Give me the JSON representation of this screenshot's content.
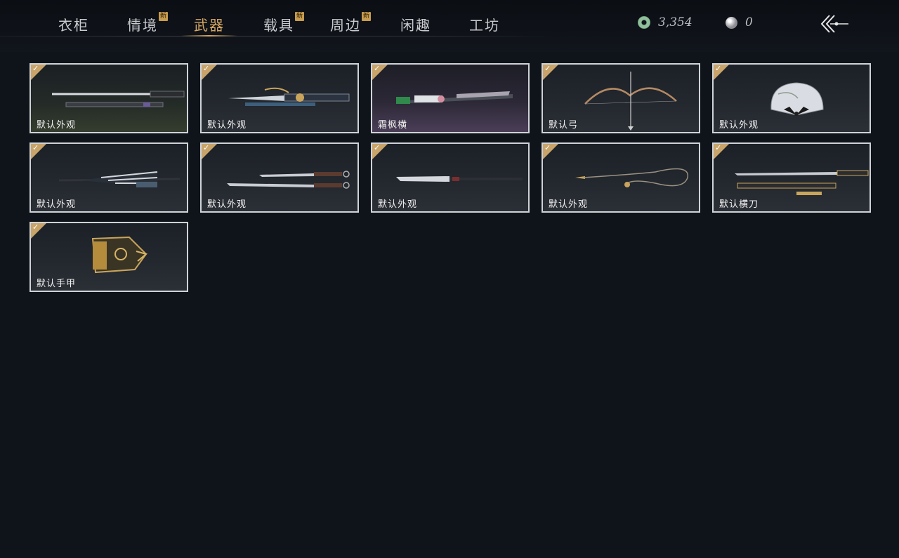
{
  "tabs": [
    {
      "label": "衣柜",
      "new": false,
      "active": false
    },
    {
      "label": "情境",
      "new": true,
      "active": false
    },
    {
      "label": "武器",
      "new": false,
      "active": true
    },
    {
      "label": "载具",
      "new": true,
      "active": false
    },
    {
      "label": "周边",
      "new": true,
      "active": false
    },
    {
      "label": "闲趣",
      "new": false,
      "active": false
    },
    {
      "label": "工坊",
      "new": false,
      "active": false
    }
  ],
  "new_badge": "新",
  "currency": {
    "jade": "3,354",
    "pearl": "0"
  },
  "check_glyph": "✓",
  "items": [
    {
      "label": "默认外观",
      "art": "sword-icon",
      "equipped": true
    },
    {
      "label": "默认外观",
      "art": "ornate-sword-icon",
      "equipped": true
    },
    {
      "label": "霜枫横",
      "art": "jade-blade-icon",
      "equipped": true
    },
    {
      "label": "默认弓",
      "art": "bow-icon",
      "equipped": true
    },
    {
      "label": "默认外观",
      "art": "fan-icon",
      "equipped": true
    },
    {
      "label": "默认外观",
      "art": "umbrella-icon",
      "equipped": true
    },
    {
      "label": "默认外观",
      "art": "twin-blades-icon",
      "equipped": true
    },
    {
      "label": "默认外观",
      "art": "spear-icon",
      "equipped": true
    },
    {
      "label": "默认外观",
      "art": "rope-dart-icon",
      "equipped": true
    },
    {
      "label": "默认横刀",
      "art": "sabre-icon",
      "equipped": true
    },
    {
      "label": "默认手甲",
      "art": "gauntlet-icon",
      "equipped": true
    }
  ],
  "colors": {
    "accent": "#d6a863",
    "badge": "#c79c4e",
    "check": "#c8a46a",
    "card_border": "#cfd3d8",
    "background": "#0f131a"
  }
}
